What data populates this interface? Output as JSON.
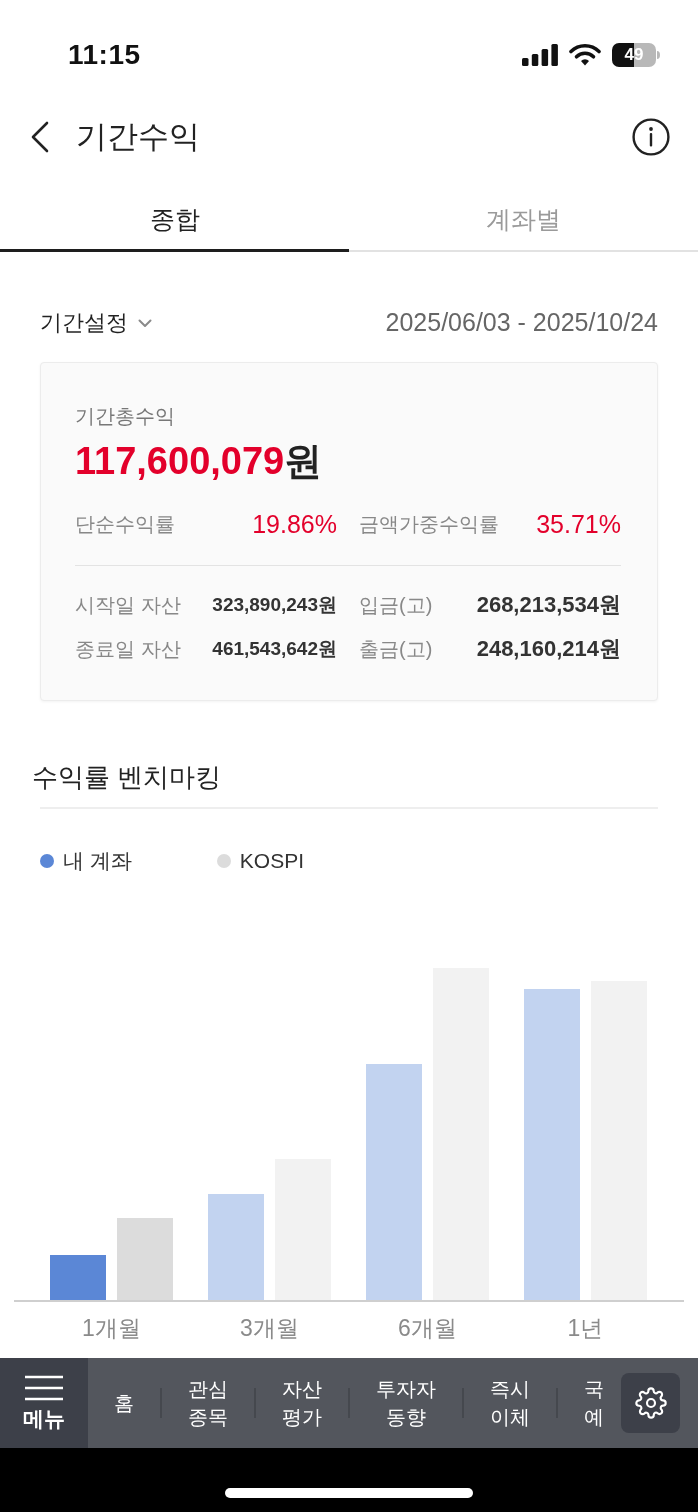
{
  "status_bar": {
    "time": "11:15",
    "battery": "49"
  },
  "header": {
    "title": "기간수익"
  },
  "tabs": [
    {
      "label": "종합",
      "selected": true
    },
    {
      "label": "계좌별",
      "selected": false
    }
  ],
  "period": {
    "label": "기간설정",
    "range": "2025/06/03 - 2025/10/24"
  },
  "summary": {
    "title": "기간총수익",
    "amount": "117,600,079",
    "unit": "원",
    "rates": [
      {
        "label": "단순수익률",
        "value": "19.86%"
      },
      {
        "label": "금액가중수익률",
        "value": "35.71%"
      }
    ],
    "assets": [
      {
        "label": "시작일 자산",
        "value": "323,890,243원"
      },
      {
        "label": "입금(고)",
        "value": "268,213,534원"
      },
      {
        "label": "종료일 자산",
        "value": "461,543,642원"
      },
      {
        "label": "출금(고)",
        "value": "248,160,214원"
      }
    ]
  },
  "benchmark": {
    "title": "수익률 벤치마킹",
    "legend": [
      {
        "label": "내 계좌",
        "color": "#5b87d6"
      },
      {
        "label": "KOSPI",
        "color": "#dcdcdc"
      }
    ],
    "categories": [
      {
        "label": "1개월",
        "selected": true
      },
      {
        "label": "3개월",
        "selected": false
      },
      {
        "label": "6개월",
        "selected": false
      },
      {
        "label": "1년",
        "selected": false
      }
    ]
  },
  "bottom_nav": {
    "menu": "메뉴",
    "items": [
      {
        "lines": [
          "홈"
        ]
      },
      {
        "lines": [
          "관심",
          "종목"
        ]
      },
      {
        "lines": [
          "자산",
          "평가"
        ]
      },
      {
        "lines": [
          "투자자",
          "동향"
        ]
      },
      {
        "lines": [
          "즉시",
          "이체"
        ]
      },
      {
        "lines": [
          "국",
          "예"
        ]
      }
    ]
  }
}
